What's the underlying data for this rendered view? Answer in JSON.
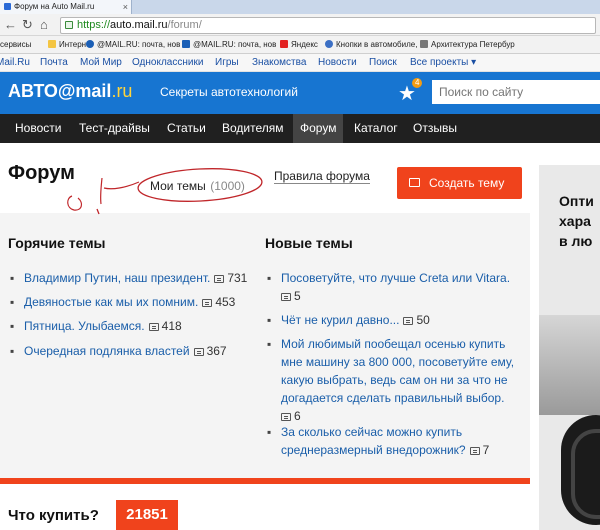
{
  "browser": {
    "tab_title": "Форум на Auto Mail.ru",
    "tab_close": "×",
    "url_scheme": "https://",
    "url_host": "auto.mail.ru",
    "url_path": "/forum/",
    "bookmarks": [
      {
        "label": "сервисы"
      },
      {
        "label": "Интернет"
      },
      {
        "label": "@MAIL.RU: почта, нов"
      },
      {
        "label": "@MAIL.RU: почта, нов"
      },
      {
        "label": "Яндекс"
      },
      {
        "label": "Кнопки в автомобиле,"
      },
      {
        "label": "Архитектура Петербур"
      }
    ]
  },
  "portal": {
    "items": [
      "Mail.Ru",
      "Почта",
      "Мой Мир",
      "Одноклассники",
      "Игры",
      "Знакомства",
      "Новости",
      "Поиск",
      "Все проекты ▾"
    ]
  },
  "header": {
    "logo_main": "АВТО@mail",
    "logo_ru": ".ru",
    "tagline": "Секреты автотехнологий",
    "star_badge": "4",
    "search_placeholder": "Поиск по сайту"
  },
  "nav": {
    "items": [
      "Новости",
      "Тест-драйвы",
      "Статьи",
      "Водителям",
      "Форум",
      "Каталог",
      "Отзывы"
    ],
    "active": "Форум"
  },
  "forum": {
    "title": "Форум",
    "my_themes_label": "Мои темы",
    "my_themes_count": "(1000)",
    "rules_label": "Правила форума",
    "create_label": "Создать тему"
  },
  "hot": {
    "title": "Горячие темы",
    "topics": [
      {
        "title": "Владимир Путин, наш президент.",
        "count": "731"
      },
      {
        "title": "Девяностые как мы их помним.",
        "count": "453"
      },
      {
        "title": "Пятница. Улыбаемся.",
        "count": "418"
      },
      {
        "title": "Очередная подлянка властей",
        "count": "367"
      }
    ]
  },
  "new": {
    "title": "Новые темы",
    "topics": [
      {
        "title": "Посоветуйте, что лучше Creta или Vitara.",
        "count": "5"
      },
      {
        "title": "Чёт не курил давно...",
        "count": "50"
      },
      {
        "title": "Мой любимый пообещал осенью купить мне машину за 800 000, посоветуйте ему, какую выбрать, ведь сам он ни за что не догадается сделать правильный выбор.",
        "count": "6"
      },
      {
        "title": "За сколько сейчас можно купить среднеразмерный внедорожник?",
        "count": "7"
      }
    ]
  },
  "buy": {
    "label": "Что купить?",
    "count": "21851"
  },
  "ad": {
    "lines": [
      "Опти",
      "хара",
      "в лю"
    ]
  },
  "colors": {
    "header_blue": "#1775d1",
    "accent_red": "#f0431c",
    "nav_dark": "#202020",
    "link_blue": "#1a5ea9"
  }
}
